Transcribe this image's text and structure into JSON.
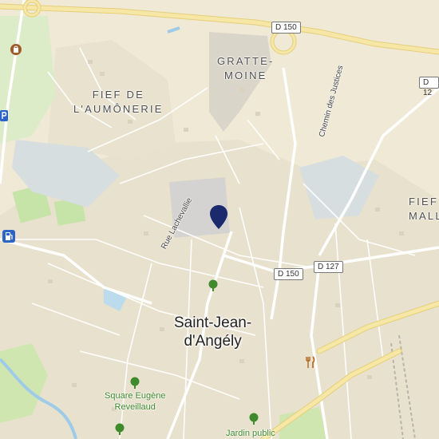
{
  "map": {
    "districts": [
      "FIEF DE",
      "L'AUMÔNERIE",
      "GRATTE-",
      "MOINE",
      "FIEF",
      "MALL"
    ],
    "town": [
      "Saint-Jean-",
      "d'Angély"
    ],
    "roads": {
      "d150_top": "D 150",
      "d150_mid": "D 150",
      "d127": "D 127",
      "d12": "D 12"
    },
    "streets": {
      "rue_lachevallie": "Rue Lachevallie",
      "chemin_justices": "Chemin des Justices"
    },
    "pois": {
      "square": [
        "Square Eugène",
        "Reveillaud"
      ],
      "jardin": "Jardin public"
    },
    "colors": {
      "background": "#efe9d6",
      "major_road": "#f7e7a6",
      "park": "#cfe6b0",
      "water": "#a9d3ee",
      "marker": "#1a2a6c"
    },
    "icons": [
      "location-pin-icon",
      "tree-icon",
      "restaurant-icon",
      "fuel-station-icon",
      "parking-icon",
      "shopping-icon"
    ]
  }
}
